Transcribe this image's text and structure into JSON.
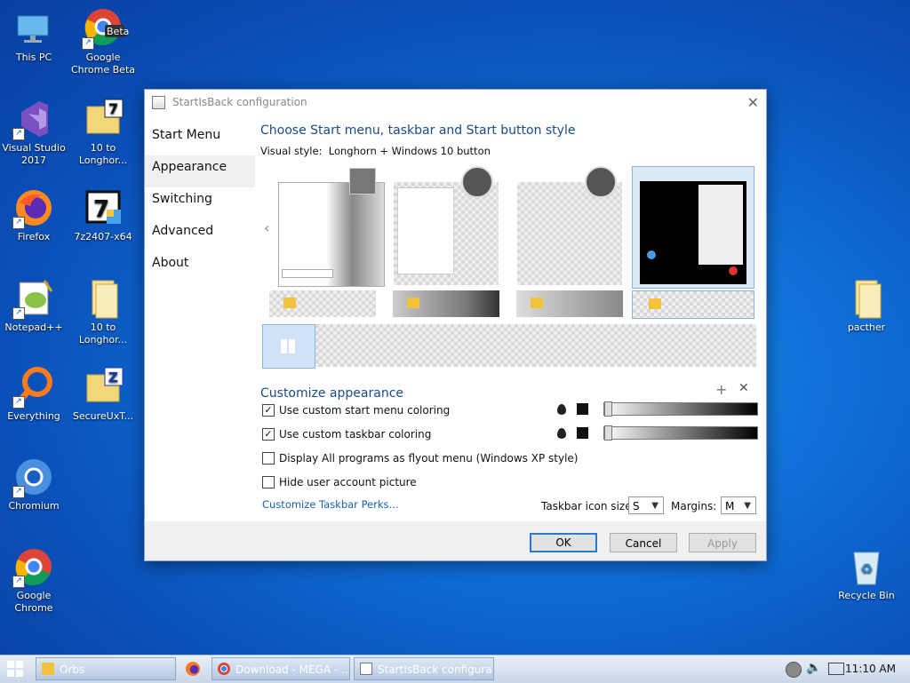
{
  "desktop": {
    "icons": [
      {
        "label": "This PC"
      },
      {
        "label": "Google Chrome Beta",
        "badge": "Beta"
      },
      {
        "label": "Visual Studio 2017"
      },
      {
        "label": "10 to Longhor..."
      },
      {
        "label": "Firefox"
      },
      {
        "label": "7z2407-x64",
        "badge": "7"
      },
      {
        "label": "Notepad++"
      },
      {
        "label": "10 to Longhor..."
      },
      {
        "label": "Everything"
      },
      {
        "label": "SecureUxT..."
      },
      {
        "label": "Chromium"
      },
      {
        "label": "Google Chrome"
      },
      {
        "label": "pacther"
      },
      {
        "label": "Recycle Bin"
      }
    ]
  },
  "dialog": {
    "title": "StartIsBack configuration",
    "nav": [
      "Start Menu",
      "Appearance",
      "Switching",
      "Advanced",
      "About"
    ],
    "selected_nav": "Appearance",
    "heading": "Choose Start menu, taskbar and Start button style",
    "visual_style_label": "Visual style:",
    "visual_style_value": "Longhorn + Windows 10 button",
    "customize_heading": "Customize appearance",
    "options": [
      {
        "label": "Use custom start menu coloring",
        "checked": true
      },
      {
        "label": "Use custom taskbar coloring",
        "checked": true
      },
      {
        "label": "Display All programs as flyout menu (Windows XP style)",
        "checked": false
      },
      {
        "label": "Hide user account picture",
        "checked": false
      }
    ],
    "perks_link": "Customize Taskbar Perks...",
    "icon_size_label": "Taskbar icon size:",
    "icon_size_value": "S",
    "margins_label": "Margins:",
    "margins_value": "M",
    "buttons": {
      "ok": "OK",
      "cancel": "Cancel",
      "apply": "Apply"
    }
  },
  "taskbar": {
    "items": [
      "Orbs",
      "Download - MEGA - ...",
      "StartIsBack configura..."
    ],
    "clock": "11:10 AM"
  },
  "colors": {
    "accent": "#1a4a8c",
    "link": "#1a5fb4",
    "desktop": "#0f6fd8"
  }
}
